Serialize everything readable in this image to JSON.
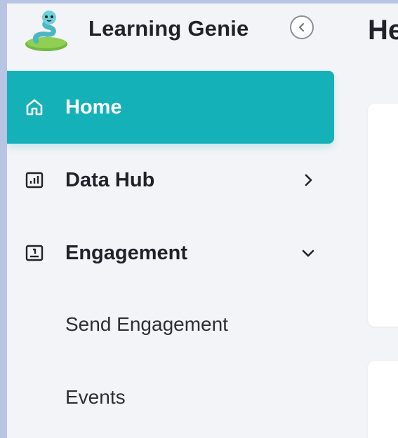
{
  "app": {
    "name": "Learning Genie"
  },
  "sidebar": {
    "items": [
      {
        "label": "Home",
        "icon": "home-icon",
        "active": true
      },
      {
        "label": "Data Hub",
        "icon": "bar-chart-icon",
        "chevron": "chevron-right-icon"
      },
      {
        "label": "Engagement",
        "icon": "engagement-icon",
        "chevron": "chevron-down-icon",
        "expanded": true
      }
    ],
    "subitems": [
      {
        "label": "Send Engagement"
      },
      {
        "label": "Events"
      }
    ]
  },
  "main": {
    "title": "He"
  },
  "colors": {
    "accent": "#14b1b8",
    "background": "#f3f4f7",
    "frame": "#b8c4e4"
  }
}
